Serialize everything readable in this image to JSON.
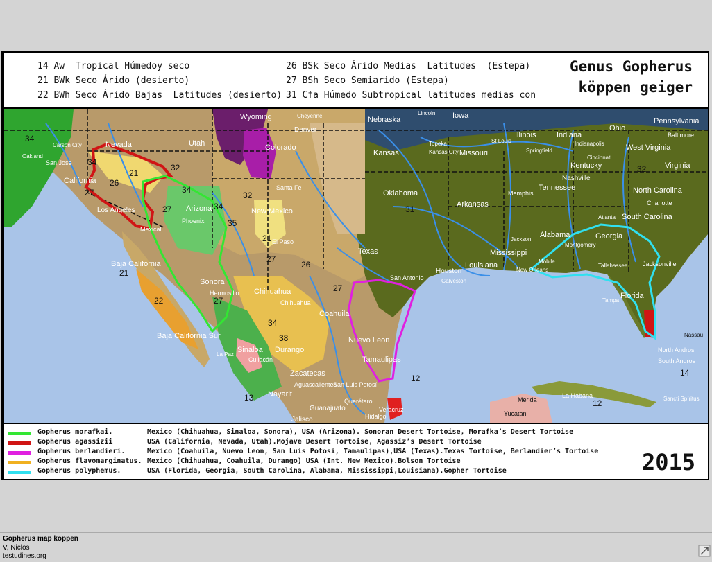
{
  "koppen_legend": {
    "col1": [
      {
        "code": "14 Aw",
        "desc": "Tropical Húmedoy seco"
      },
      {
        "code": "21 BWk",
        "desc": "Seco Árido (desierto)"
      },
      {
        "code": "22 BWh",
        "desc": "Seco Árido Bajas  Latitudes (desierto)"
      }
    ],
    "col2": [
      {
        "code": "26 BSk",
        "desc": "Seco Árido Medias  Latitudes  (Estepa)"
      },
      {
        "code": "27 BSh",
        "desc": "Seco Semiarido (Estepa)"
      },
      {
        "code": "31 Cfa",
        "desc": "Húmedo Subtropical latitudes medias con"
      }
    ]
  },
  "title": {
    "line1": "Genus Gopherus",
    "line2": "köppen geiger"
  },
  "year": "2015",
  "colors": {
    "morafkai": "#33e633",
    "agassizii": "#d01515",
    "berlandieri": "#e020e0",
    "flavomarginatus": "#f0b020",
    "polyphemus": "#30e0f0",
    "river": "#3a8fe8",
    "ocean": "#a9c4e8"
  },
  "species_legend": [
    {
      "name": "Gopherus morafkai.",
      "desc": "Mexico (Chihuahua, Sinaloa, Sonora), USA (Arizona). Sonoran Desert Tortoise, Morafka’s Desert Tortoise",
      "color": "#33e633"
    },
    {
      "name": "Gopherus agassizii",
      "desc": "USA (California, Nevada, Utah).Mojave Desert Tortoise, Agassiz’s Desert Tortoise",
      "color": "#d01515"
    },
    {
      "name": "Gopherus berlandieri.",
      "desc": "Mexico (Coahuila, Nuevo Leon, San Luis Potosi, Tamaulipas),USA (Texas).Texas Tortoise, Berlandier’s Tortoise",
      "color": "#e020e0"
    },
    {
      "name": "Gopherus flavomarginatus.",
      "desc": "Mexico (Chihuahua, Coahuila, Durango) USA (Int. New Mexico).Bolson Tortoise",
      "color": "#f0b020"
    },
    {
      "name": "Gopherus polyphemus.",
      "desc": "USA (Florida, Georgia, South Carolina, Alabama, Mississippi,Louisiana).Gopher Tortoise",
      "color": "#30e0f0"
    }
  ],
  "map_labels": {
    "wyoming": "Wyoming",
    "nebraska": "Nebraska",
    "iowa": "Iowa",
    "illinois": "Illinois",
    "indiana": "Indiana",
    "ohio": "Ohio",
    "pennsylvania": "Pennsylvania",
    "baltimore": "Baltimore",
    "nevada": "Nevada",
    "utah": "Utah",
    "colorado": "Colorado",
    "denver": "Denver",
    "kansas": "Kansas",
    "missouri": "Missouri",
    "kentucky": "Kentucky",
    "west_virginia": "West Virginia",
    "virginia": "Virginia",
    "california": "California",
    "san_jose": "San Jose",
    "oakland": "Oakland",
    "carson_city": "Carson City",
    "santa_fe": "Santa Fe",
    "new_mexico": "New Mexico",
    "oklahoma": "Oklahoma",
    "arkansas": "Arkansas",
    "tennessee": "Tennessee",
    "nashville": "Nashville",
    "memphis": "Memphis",
    "north_carolina": "North Carolina",
    "charlotte": "Charlotte",
    "south_carolina": "South Carolina",
    "georgia": "Georgia",
    "atlanta": "Atlanta",
    "alabama": "Alabama",
    "mississippi": "Mississippi",
    "jackson": "Jackson",
    "montgomery": "Montgomery",
    "louisiana": "Louisiana",
    "texas": "Texas",
    "houston": "Houston",
    "san_antonio": "San Antonio",
    "galveston": "Galveston",
    "el_paso": "El Paso",
    "los_angeles": "Los Angeles",
    "mexicali": "Mexicali",
    "phoenix": "Phoenix",
    "arizona": "Arizona",
    "baja_california": "Baja California",
    "baja_california_sur": "Baja California Sur",
    "sonora": "Sonora",
    "hermosillo": "Hermosillo",
    "chihuahua": "Chihuahua",
    "chihuahua_city": "Chihuahua",
    "coahuila": "Coahuila",
    "nuevo_leon": "Nuevo Leon",
    "tamaulipas": "Tamaulipas",
    "sinaloa": "Sinaloa",
    "durango": "Durango",
    "zacatecas": "Zacatecas",
    "culiacan": "Culiacán",
    "la_paz": "La Paz",
    "san_luis_potosi": "San Luis Potosí",
    "aguascalientes": "Aguascalientes",
    "nayarit": "Nayarit",
    "queretaro": "Querétaro",
    "guanajuato": "Guanajuato",
    "hidalgo": "Hidalgo",
    "jalisco": "Jalisco",
    "veracruz": "Veracruz",
    "tallahassee": "Tallahassee",
    "jacksonville": "Jacksonville",
    "florida": "Florida",
    "tampa": "Tampa",
    "mobile": "Mobile",
    "new_orleans": "New Orleans",
    "cheyenne": "Cheyenne",
    "lincoln": "Lincoln",
    "kansas_city": "Kansas City",
    "topeka": "Topeka",
    "st_louis": "St Louis",
    "cincinnati": "Cincinnati",
    "indianapolis": "Indianapolis",
    "springfield": "Springfield",
    "nassau": "Nassau",
    "merida": "Merida",
    "yucatan": "Yucatan",
    "havana": "La Habana",
    "santi_spiritus": "Sancti Spíritus",
    "south_andros": "South Andros",
    "north_andros": "North Andros"
  },
  "caption": {
    "title": "Gopherus map koppen",
    "author": "V, Niclos",
    "site": "testudines.org"
  }
}
